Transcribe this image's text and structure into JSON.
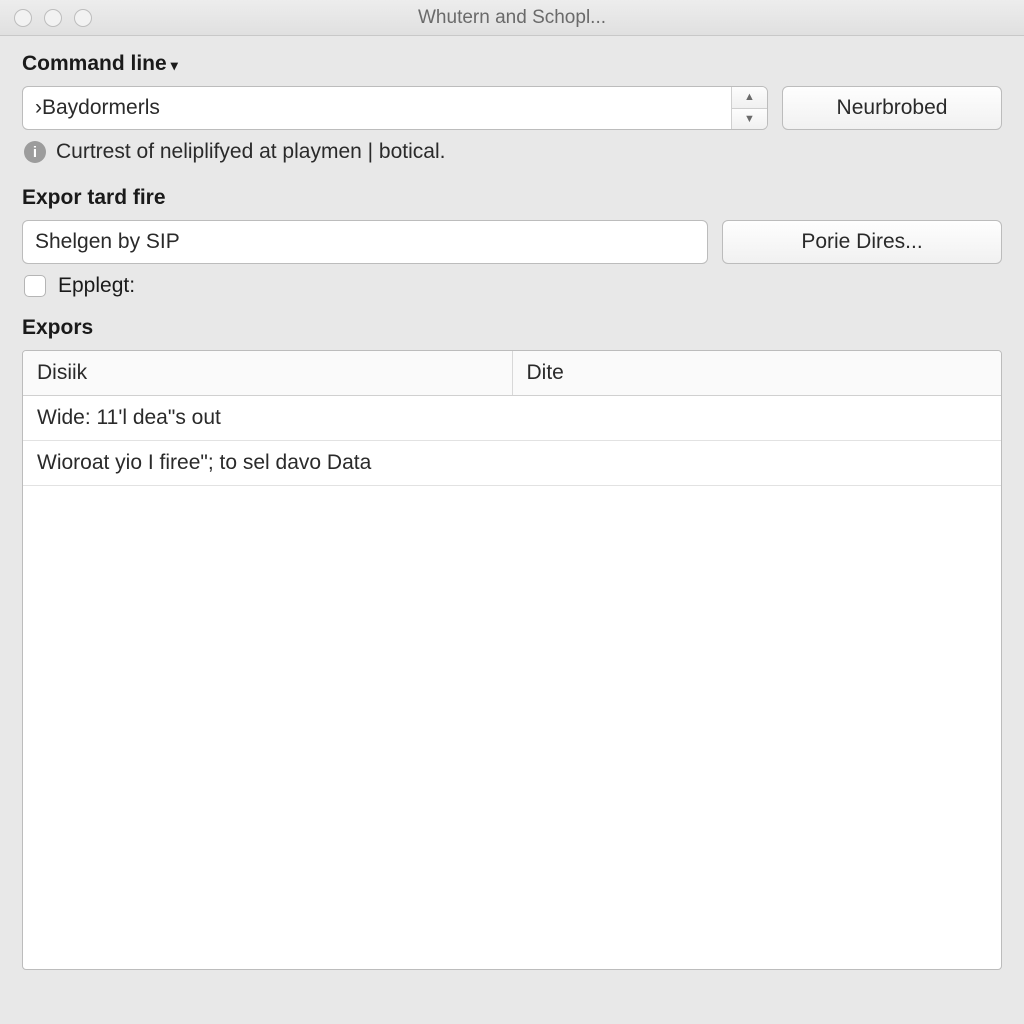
{
  "window": {
    "title": "Whutern and Schopl..."
  },
  "command": {
    "label": "Command line",
    "value": "›Baydormerls",
    "button": "Neurbrobed",
    "info": "Curtrest of neliplifyed at playmen | botical."
  },
  "export_file": {
    "label": "Expor tard fire",
    "value": "Shelgen by SIP",
    "button": "Porie Dires...",
    "checkbox_label": "Epplegt:"
  },
  "exports": {
    "label": "Expors",
    "columns": [
      "Disiik",
      "Dite"
    ],
    "rows": [
      {
        "a": "Wide: 11'l  dea\"s out",
        "b": ""
      },
      {
        "a": "Wioroat yio I firee\"; to sel davo Data",
        "b": ""
      }
    ]
  }
}
